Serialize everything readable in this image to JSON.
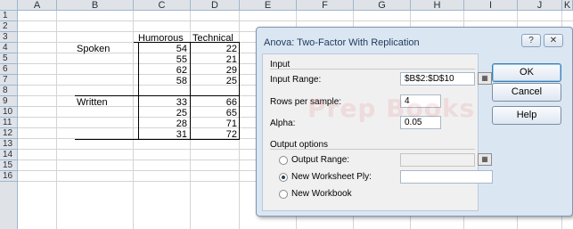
{
  "sheet": {
    "columns": [
      "A",
      "B",
      "C",
      "D",
      "E",
      "F",
      "G",
      "H",
      "I",
      "J",
      "K"
    ],
    "rows": [
      "1",
      "2",
      "3",
      "4",
      "5",
      "6",
      "7",
      "8",
      "9",
      "10",
      "11",
      "12",
      "13",
      "14",
      "15",
      "16"
    ],
    "header_humorous": "Humorous",
    "header_technical": "Technical",
    "label_spoken": "Spoken",
    "label_written": "Written",
    "humorous": [
      "54",
      "55",
      "62",
      "58",
      "33",
      "25",
      "28",
      "31"
    ],
    "technical": [
      "22",
      "21",
      "29",
      "25",
      "66",
      "65",
      "71",
      "72"
    ],
    "watermark": "Prep Books"
  },
  "dialog": {
    "title": "Anova: Two-Factor With Replication",
    "help_icon": "?",
    "close_icon": "✕",
    "input_group": "Input",
    "input_range_label": "Input Range:",
    "input_range_value": "$B$2:$D$10",
    "rows_label": "Rows per sample:",
    "rows_value": "4",
    "alpha_label": "Alpha:",
    "alpha_value": "0.05",
    "output_group": "Output options",
    "output_range_label": "Output Range:",
    "output_range_value": "",
    "new_ply_label": "New Worksheet Ply:",
    "new_ply_value": "",
    "new_workbook_label": "New Workbook",
    "selected_output": "New Worksheet Ply",
    "ok": "OK",
    "cancel": "Cancel",
    "help": "Help"
  }
}
